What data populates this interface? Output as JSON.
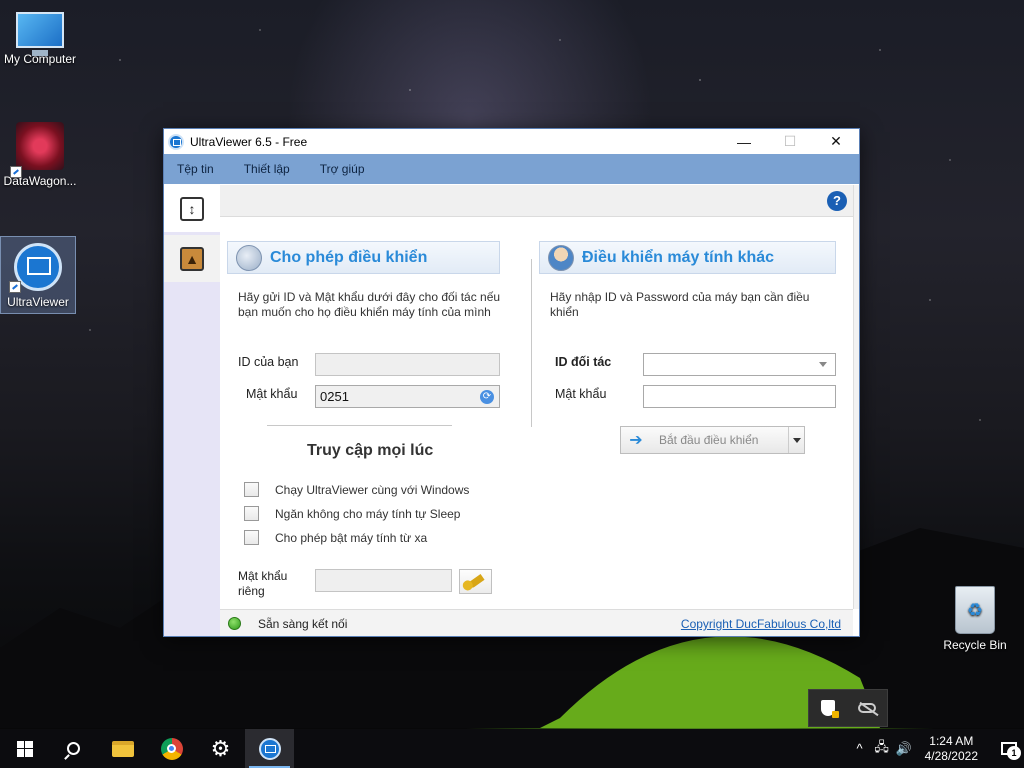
{
  "desktop": {
    "icons": [
      {
        "label": "My Computer",
        "icon": "monitor-icon"
      },
      {
        "label": "DataWagon...",
        "icon": "datawagon-icon"
      },
      {
        "label": "UltraViewer",
        "icon": "ultraviewer-icon"
      },
      {
        "label": "Recycle Bin",
        "icon": "recycle-bin-icon"
      }
    ]
  },
  "window": {
    "title": "UltraViewer 6.5 - Free",
    "controls": {
      "minimize": "—",
      "maximize": "☐",
      "close": "✕"
    },
    "menu": [
      "Tệp tin",
      "Thiết lập",
      "Trợ giúp"
    ],
    "sidebar": [
      {
        "icon": "swap-arrows-icon",
        "glyph": "↕",
        "active": true
      },
      {
        "icon": "contacts-book-icon",
        "glyph": "▲",
        "active": false
      }
    ],
    "help_glyph": "?",
    "allow_control": {
      "heading": "Cho phép điều khiển",
      "description": "Hãy gửi ID và Mật khẩu dưới đây cho đối tác nếu bạn muốn cho họ điều khiển máy tính của mình",
      "id_label": "ID của bạn",
      "id_value": "",
      "password_label": "Mật khẩu",
      "password_value": "0251",
      "refresh_glyph": "⟳"
    },
    "always_access": {
      "heading": "Truy cập mọi lúc",
      "options": [
        {
          "label": "Chạy UltraViewer cùng với Windows",
          "checked": false
        },
        {
          "label": "Ngăn không cho máy tính tự Sleep",
          "checked": false
        },
        {
          "label": "Cho phép bật máy tính từ xa",
          "checked": false
        }
      ],
      "private_password_label": "Mật khẩu riêng",
      "private_password_value": ""
    },
    "control_other": {
      "heading": "Điều khiển máy tính khác",
      "description": "Hãy nhập ID và Password của máy bạn cần điều khiển",
      "partner_id_label": "ID đối tác",
      "partner_id_value": "",
      "password_label": "Mật khẩu",
      "password_value": "",
      "connect_button": "Bắt đầu điều khiển",
      "connect_glyph": "➔"
    },
    "status": {
      "text": "Sẵn sàng kết nối",
      "state_color": "#2e9a1a",
      "copyright": "Copyright DucFabulous Co,ltd"
    }
  },
  "taskbar": {
    "pinned": [
      "start-button",
      "search-button",
      "file-explorer",
      "chrome",
      "settings",
      "ultraviewer"
    ],
    "gear_glyph": "⚙",
    "tray_glyphs": {
      "chevron": "^",
      "network": "🖧",
      "volume": "🔊"
    },
    "time": "1:24 AM",
    "date": "4/28/2022",
    "notification_count": "1"
  },
  "colors": {
    "menubar": "#7ba2d2",
    "accent": "#2a8ad8",
    "sidebar": "#e6e4f6"
  }
}
